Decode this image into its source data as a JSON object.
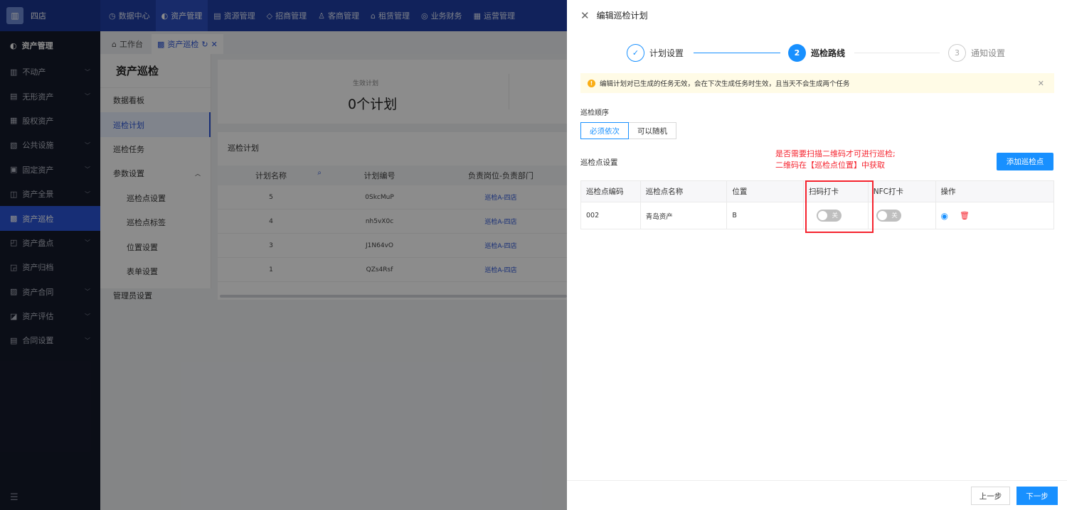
{
  "app": {
    "org_name": "四店"
  },
  "topnav": [
    {
      "icon": "◷",
      "label": "数据中心"
    },
    {
      "icon": "◐",
      "label": "资产管理",
      "active": true
    },
    {
      "icon": "▤",
      "label": "资源管理"
    },
    {
      "icon": "◇",
      "label": "招商管理"
    },
    {
      "icon": "♙",
      "label": "客商管理"
    },
    {
      "icon": "⌂",
      "label": "租赁管理"
    },
    {
      "icon": "◎",
      "label": "业务财务"
    },
    {
      "icon": "▦",
      "label": "运营管理"
    }
  ],
  "sidebar": {
    "header": "资产管理",
    "items": [
      {
        "icon": "▥",
        "label": "不动产",
        "has_children": true
      },
      {
        "icon": "▤",
        "label": "无形资产",
        "has_children": true
      },
      {
        "icon": "▦",
        "label": "股权资产",
        "has_children": false
      },
      {
        "icon": "▧",
        "label": "公共设施",
        "has_children": true
      },
      {
        "icon": "▣",
        "label": "固定资产",
        "has_children": true
      },
      {
        "icon": "◫",
        "label": "资产全景",
        "has_children": true
      },
      {
        "icon": "▩",
        "label": "资产巡检",
        "has_children": false,
        "active": true
      },
      {
        "icon": "◰",
        "label": "资产盘点",
        "has_children": true
      },
      {
        "icon": "◲",
        "label": "资产归档",
        "has_children": false
      },
      {
        "icon": "▨",
        "label": "资产合同",
        "has_children": true
      },
      {
        "icon": "◪",
        "label": "资产评估",
        "has_children": true
      },
      {
        "icon": "▤",
        "label": "合同设置",
        "has_children": true
      }
    ],
    "footer_icon": "☰"
  },
  "tabs": [
    {
      "icon": "⌂",
      "label": "工作台"
    },
    {
      "icon": "▩",
      "label": "资产巡检",
      "active": true
    }
  ],
  "submenu": {
    "title": "资产巡检",
    "items": [
      {
        "label": "数据看板",
        "level": 1
      },
      {
        "label": "巡检计划",
        "level": 1,
        "active": true
      },
      {
        "label": "巡检任务",
        "level": 1
      },
      {
        "label": "参数设置",
        "level": 1,
        "expanded": true
      },
      {
        "label": "巡检点设置",
        "level": 2
      },
      {
        "label": "巡检点标签",
        "level": 2
      },
      {
        "label": "位置设置",
        "level": 2
      },
      {
        "label": "表单设置",
        "level": 2
      },
      {
        "label": "管理员设置",
        "level": 1
      }
    ]
  },
  "stats": {
    "label": "生效计划",
    "value": "0个计划"
  },
  "plan_table": {
    "title": "巡检计划",
    "columns": [
      "计划名称",
      "计划编号",
      "负责岗位-负责部门"
    ],
    "rows": [
      [
        "5",
        "0SkcMuP",
        "巡检A-四店"
      ],
      [
        "4",
        "nh5vX0c",
        "巡检A-四店"
      ],
      [
        "3",
        "J1N64vO",
        "巡检A-四店"
      ],
      [
        "1",
        "QZs4Rsf",
        "巡检A-四店"
      ]
    ]
  },
  "drawer": {
    "title": "编辑巡检计划",
    "steps": [
      {
        "num": "✓",
        "label": "计划设置",
        "state": "done"
      },
      {
        "num": "2",
        "label": "巡检路线",
        "state": "active"
      },
      {
        "num": "3",
        "label": "通知设置",
        "state": "wait"
      }
    ],
    "alert": "编辑计划对已生成的任务无效，会在下次生成任务时生效，且当天不会生成两个任务",
    "order_label": "巡检顺序",
    "order_options": [
      "必须依次",
      "可以随机"
    ],
    "point_label": "巡检点设置",
    "annotation_line1": "是否需要扫描二维码才可进行巡检;",
    "annotation_line2": "二维码在【巡检点位置】中获取",
    "add_button": "添加巡检点",
    "table": {
      "columns": [
        "巡检点编码",
        "巡检点名称",
        "位置",
        "扫码打卡",
        "NFC打卡",
        "操作"
      ],
      "rows": [
        {
          "code": "002",
          "name": "青岛资产",
          "location": "B",
          "scan": "关",
          "nfc": "关"
        }
      ]
    },
    "prev_button": "上一步",
    "next_button": "下一步"
  },
  "colors": {
    "primary": "#1890ff",
    "brand": "#1f3ea6",
    "sidebar": "#151a2b",
    "annotation": "#f5222d"
  }
}
